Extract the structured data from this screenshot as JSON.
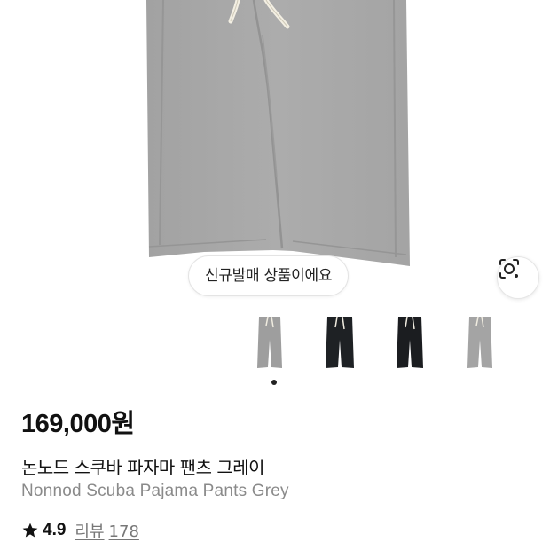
{
  "hero": {
    "badge_text": "신규발매 상품이에요",
    "lens_icon": "camera-lens-search-icon"
  },
  "thumbnails": [
    {
      "color": "grey",
      "fill": "#9e9e9e"
    },
    {
      "color": "black",
      "fill": "#1e2124"
    },
    {
      "color": "black",
      "fill": "#1b1d20"
    },
    {
      "color": "grey",
      "fill": "#a4a4a4"
    }
  ],
  "carousel": {
    "active_index": 0
  },
  "product": {
    "price": "169,000원",
    "title_ko": "논노드 스쿠바 파자마 팬츠 그레이",
    "title_en": "Nonnod Scuba Pajama Pants Grey",
    "rating": "4.9",
    "review_label": "리뷰",
    "review_count": "178"
  },
  "colors": {
    "pants_grey": "#a9a9a9",
    "text_primary": "#111111",
    "text_secondary": "#8a8a8a"
  }
}
